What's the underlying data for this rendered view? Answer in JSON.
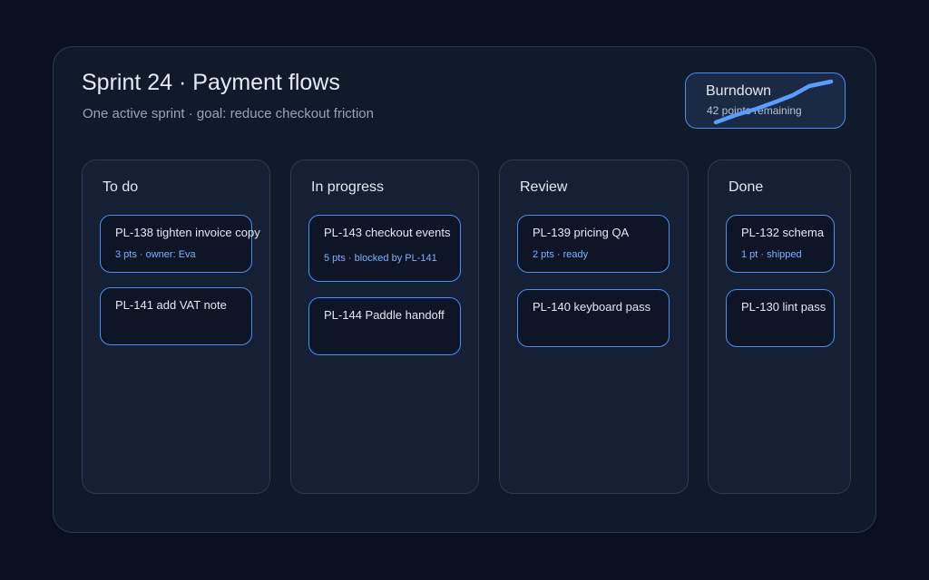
{
  "header": {
    "title": "Sprint 24 · Payment flows",
    "subtitle": "One active sprint · goal: reduce checkout friction"
  },
  "burndown": {
    "title": "Burndown",
    "meta": "42 points remaining"
  },
  "columns": [
    {
      "title": "To do",
      "cards": [
        {
          "title": "PL-138 tighten invoice copy",
          "meta": "3 pts · owner: Eva"
        },
        {
          "title": "PL-141 add VAT note",
          "meta": ""
        }
      ]
    },
    {
      "title": "In progress",
      "cards": [
        {
          "title": "PL-143 checkout events",
          "meta": "5 pts · blocked by PL-141"
        },
        {
          "title": "PL-144 Paddle handoff",
          "meta": ""
        }
      ]
    },
    {
      "title": "Review",
      "cards": [
        {
          "title": "PL-139 pricing QA",
          "meta": "2 pts · ready"
        },
        {
          "title": "PL-140 keyboard pass",
          "meta": ""
        }
      ]
    },
    {
      "title": "Done",
      "cards": [
        {
          "title": "PL-132 schema",
          "meta": "1 pt · shipped"
        },
        {
          "title": "PL-130 lint pass",
          "meta": ""
        }
      ]
    }
  ],
  "colors": {
    "background": "#0a1020",
    "panel": "#111a2b",
    "accent": "#4b8ef5",
    "meta_text": "#7fb0ff"
  }
}
